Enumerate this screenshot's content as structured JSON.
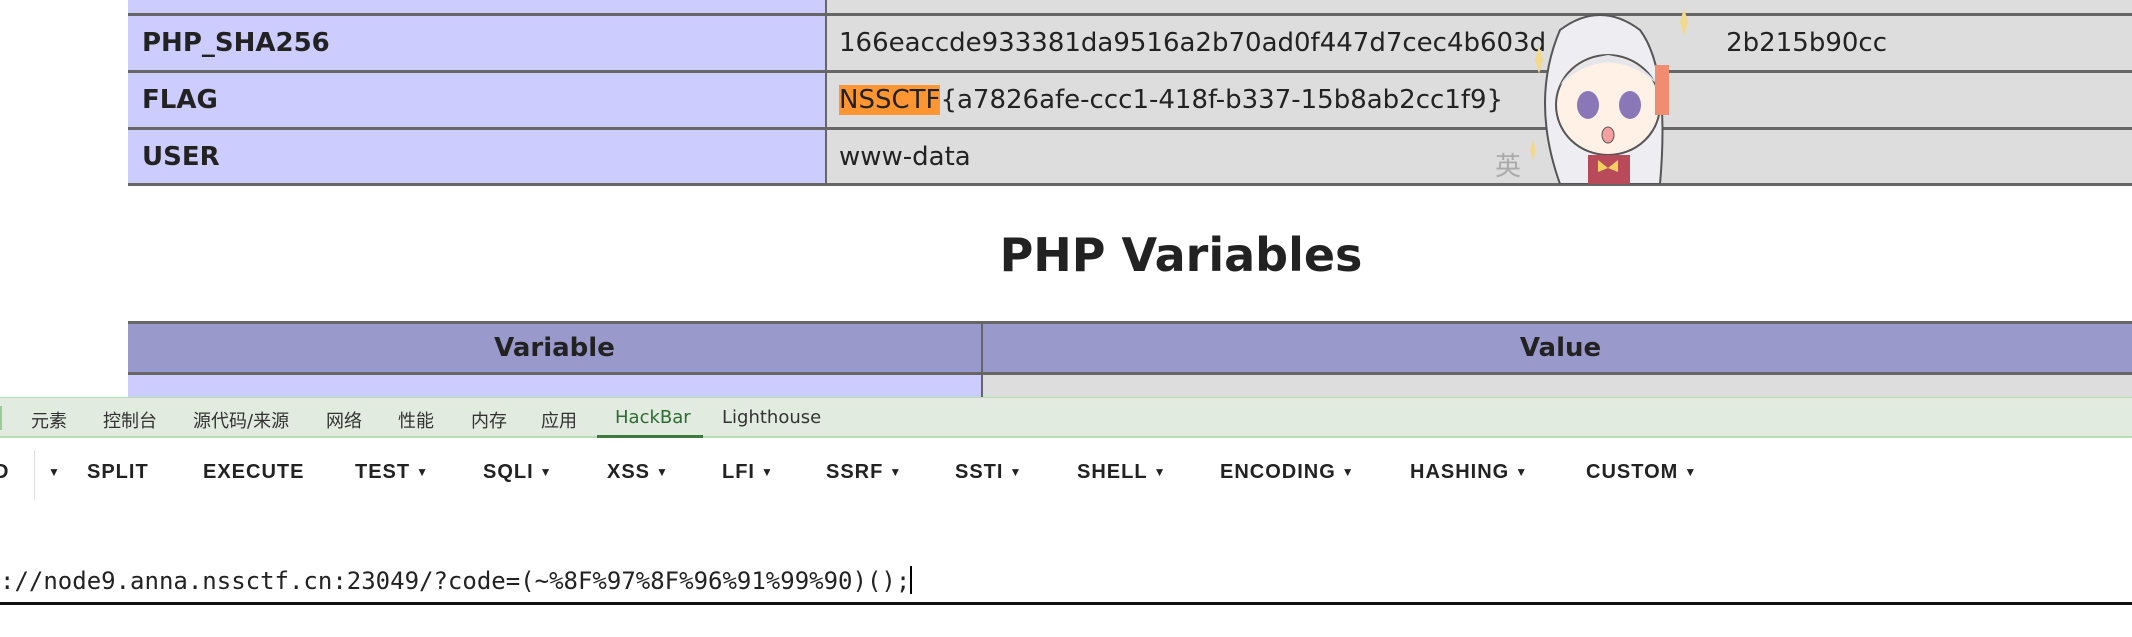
{
  "env_table": {
    "rows": [
      {
        "key": "",
        "value": ""
      },
      {
        "key": "PHP_SHA256",
        "value": "166eaccde933381da9516a2b70ad0f447d7cec4b603d",
        "value_tail": "2b215b90cc"
      },
      {
        "key": "FLAG",
        "value_highlight": "NSSCTF",
        "value": "{a7826afe-ccc1-418f-b337-15b8ab2cc1f9}"
      },
      {
        "key": "USER",
        "value": "www-data"
      }
    ]
  },
  "section_title": "PHP Variables",
  "vars_table": {
    "headers": [
      "Variable",
      "Value"
    ]
  },
  "devtools": {
    "tabs": [
      "元素",
      "控制台",
      "源代码/来源",
      "网络",
      "性能",
      "内存",
      "应用",
      "HackBar",
      "Lighthouse"
    ],
    "active_tab": "HackBar"
  },
  "hackbar": {
    "toolbar": [
      {
        "label": "D",
        "dropdown": false
      },
      {
        "label": "",
        "dropdown": true
      },
      {
        "label": "SPLIT",
        "dropdown": false
      },
      {
        "label": "EXECUTE",
        "dropdown": false
      },
      {
        "label": "TEST",
        "dropdown": true
      },
      {
        "label": "SQLI",
        "dropdown": true
      },
      {
        "label": "XSS",
        "dropdown": true
      },
      {
        "label": "LFI",
        "dropdown": true
      },
      {
        "label": "SSRF",
        "dropdown": true
      },
      {
        "label": "SSTI",
        "dropdown": true
      },
      {
        "label": "SHELL",
        "dropdown": true
      },
      {
        "label": "ENCODING",
        "dropdown": true
      },
      {
        "label": "HASHING",
        "dropdown": true
      },
      {
        "label": "CUSTOM",
        "dropdown": true
      }
    ],
    "url_value": "://node9.anna.nssctf.cn:23049/?code=(~%8F%97%8F%96%91%99%90)();"
  },
  "mascot": {
    "watermark": "英"
  },
  "colors": {
    "label_bg": "#ccccff",
    "value_bg": "#dddddd",
    "header_bg": "#9999cc",
    "highlight": "#ff9632",
    "tabbar_bg": "#e2ebe0",
    "active_tab": "#2e6b32"
  }
}
